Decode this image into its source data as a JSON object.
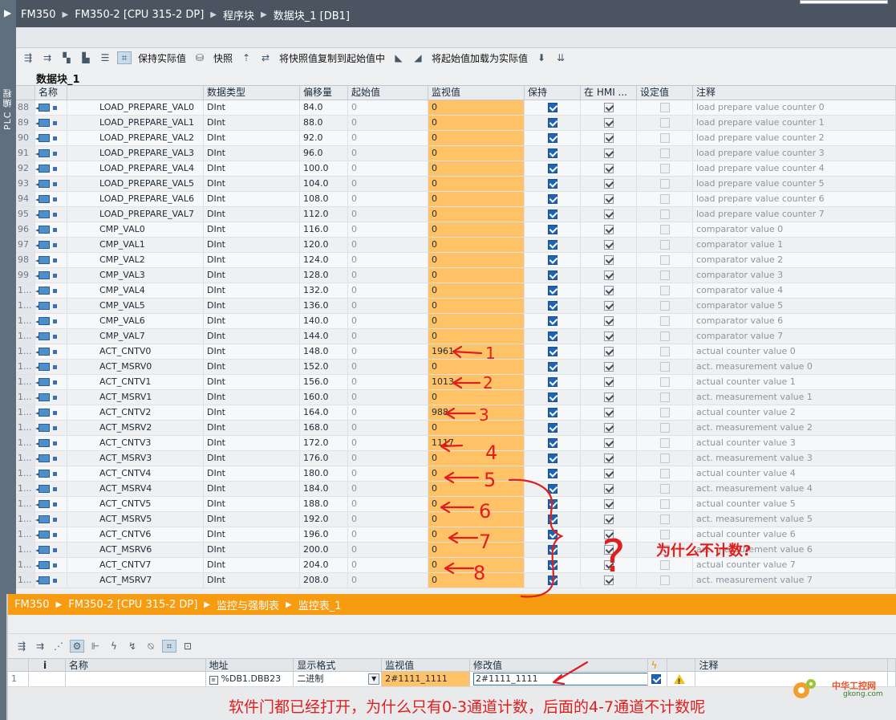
{
  "side": {
    "label": "PLC 编程"
  },
  "breadcrumb": {
    "items": [
      "FM350",
      "FM350-2 [CPU 315-2 DP]",
      "程序块",
      "数据块_1 [DB1]"
    ]
  },
  "toolbar": {
    "keep_actual": "保持实际值",
    "snapshot": "快照",
    "copy_snapshot": "将快照值复制到起始值中",
    "load_start": "将起始值加载为实际值"
  },
  "db_title": "数据块_1",
  "table": {
    "headers": [
      "名称",
      "数据类型",
      "偏移量",
      "起始值",
      "监视值",
      "保持",
      "在 HMI ...",
      "设定值",
      "注释"
    ],
    "rows": [
      {
        "no": "88",
        "name": "LOAD_PREPARE_VAL0",
        "type": "DInt",
        "offset": "84.0",
        "start": "0",
        "mon": "0",
        "comment": "load prepare value counter 0"
      },
      {
        "no": "89",
        "name": "LOAD_PREPARE_VAL1",
        "type": "DInt",
        "offset": "88.0",
        "start": "0",
        "mon": "0",
        "comment": "load prepare value counter 1"
      },
      {
        "no": "90",
        "name": "LOAD_PREPARE_VAL2",
        "type": "DInt",
        "offset": "92.0",
        "start": "0",
        "mon": "0",
        "comment": "load prepare value counter 2"
      },
      {
        "no": "91",
        "name": "LOAD_PREPARE_VAL3",
        "type": "DInt",
        "offset": "96.0",
        "start": "0",
        "mon": "0",
        "comment": "load prepare value counter 3"
      },
      {
        "no": "92",
        "name": "LOAD_PREPARE_VAL4",
        "type": "DInt",
        "offset": "100.0",
        "start": "0",
        "mon": "0",
        "comment": "load prepare value counter 4"
      },
      {
        "no": "93",
        "name": "LOAD_PREPARE_VAL5",
        "type": "DInt",
        "offset": "104.0",
        "start": "0",
        "mon": "0",
        "comment": "load prepare value counter 5"
      },
      {
        "no": "94",
        "name": "LOAD_PREPARE_VAL6",
        "type": "DInt",
        "offset": "108.0",
        "start": "0",
        "mon": "0",
        "comment": "load prepare value counter 6"
      },
      {
        "no": "95",
        "name": "LOAD_PREPARE_VAL7",
        "type": "DInt",
        "offset": "112.0",
        "start": "0",
        "mon": "0",
        "comment": "load prepare value counter 7"
      },
      {
        "no": "96",
        "name": "CMP_VAL0",
        "type": "DInt",
        "offset": "116.0",
        "start": "0",
        "mon": "0",
        "comment": "comparator value 0"
      },
      {
        "no": "97",
        "name": "CMP_VAL1",
        "type": "DInt",
        "offset": "120.0",
        "start": "0",
        "mon": "0",
        "comment": "comparator value 1"
      },
      {
        "no": "98",
        "name": "CMP_VAL2",
        "type": "DInt",
        "offset": "124.0",
        "start": "0",
        "mon": "0",
        "comment": "comparator value 2"
      },
      {
        "no": "99",
        "name": "CMP_VAL3",
        "type": "DInt",
        "offset": "128.0",
        "start": "0",
        "mon": "0",
        "comment": "comparator value 3"
      },
      {
        "no": "1...",
        "name": "CMP_VAL4",
        "type": "DInt",
        "offset": "132.0",
        "start": "0",
        "mon": "0",
        "comment": "comparator value 4"
      },
      {
        "no": "1...",
        "name": "CMP_VAL5",
        "type": "DInt",
        "offset": "136.0",
        "start": "0",
        "mon": "0",
        "comment": "comparator value 5"
      },
      {
        "no": "1...",
        "name": "CMP_VAL6",
        "type": "DInt",
        "offset": "140.0",
        "start": "0",
        "mon": "0",
        "comment": "comparator value 6"
      },
      {
        "no": "1...",
        "name": "CMP_VAL7",
        "type": "DInt",
        "offset": "144.0",
        "start": "0",
        "mon": "0",
        "comment": "comparator value 7"
      },
      {
        "no": "1...",
        "name": "ACT_CNTV0",
        "type": "DInt",
        "offset": "148.0",
        "start": "0",
        "mon": "1961",
        "comment": "actual counter value 0"
      },
      {
        "no": "1...",
        "name": "ACT_MSRV0",
        "type": "DInt",
        "offset": "152.0",
        "start": "0",
        "mon": "0",
        "comment": "act. measurement value 0"
      },
      {
        "no": "1...",
        "name": "ACT_CNTV1",
        "type": "DInt",
        "offset": "156.0",
        "start": "0",
        "mon": "1013",
        "comment": "actual counter value 1"
      },
      {
        "no": "1...",
        "name": "ACT_MSRV1",
        "type": "DInt",
        "offset": "160.0",
        "start": "0",
        "mon": "0",
        "comment": "act. measurement value 1"
      },
      {
        "no": "1...",
        "name": "ACT_CNTV2",
        "type": "DInt",
        "offset": "164.0",
        "start": "0",
        "mon": "988",
        "comment": "actual counter value 2"
      },
      {
        "no": "1...",
        "name": "ACT_MSRV2",
        "type": "DInt",
        "offset": "168.0",
        "start": "0",
        "mon": "0",
        "comment": "act. measurement value 2"
      },
      {
        "no": "1...",
        "name": "ACT_CNTV3",
        "type": "DInt",
        "offset": "172.0",
        "start": "0",
        "mon": "1117",
        "comment": "actual counter value 3"
      },
      {
        "no": "1...",
        "name": "ACT_MSRV3",
        "type": "DInt",
        "offset": "176.0",
        "start": "0",
        "mon": "0",
        "comment": "act. measurement value 3"
      },
      {
        "no": "1...",
        "name": "ACT_CNTV4",
        "type": "DInt",
        "offset": "180.0",
        "start": "0",
        "mon": "0",
        "comment": "actual counter value 4"
      },
      {
        "no": "1...",
        "name": "ACT_MSRV4",
        "type": "DInt",
        "offset": "184.0",
        "start": "0",
        "mon": "0",
        "comment": "act. measurement value 4"
      },
      {
        "no": "1...",
        "name": "ACT_CNTV5",
        "type": "DInt",
        "offset": "188.0",
        "start": "0",
        "mon": "0",
        "comment": "actual counter value 5"
      },
      {
        "no": "1...",
        "name": "ACT_MSRV5",
        "type": "DInt",
        "offset": "192.0",
        "start": "0",
        "mon": "0",
        "comment": "act. measurement value 5"
      },
      {
        "no": "1...",
        "name": "ACT_CNTV6",
        "type": "DInt",
        "offset": "196.0",
        "start": "0",
        "mon": "0",
        "comment": "actual counter value 6"
      },
      {
        "no": "1...",
        "name": "ACT_MSRV6",
        "type": "DInt",
        "offset": "200.0",
        "start": "0",
        "mon": "0",
        "comment": "act. measurement value 6"
      },
      {
        "no": "1...",
        "name": "ACT_CNTV7",
        "type": "DInt",
        "offset": "204.0",
        "start": "0",
        "mon": "0",
        "comment": "actual counter value 7"
      },
      {
        "no": "1...",
        "name": "ACT_MSRV7",
        "type": "DInt",
        "offset": "208.0",
        "start": "0",
        "mon": "0",
        "comment": "act. measurement value 7"
      }
    ]
  },
  "watch": {
    "breadcrumb": [
      "FM350",
      "FM350-2 [CPU 315-2 DP]",
      "监控与强制表",
      "监控表_1"
    ],
    "headers": [
      "i",
      "名称",
      "地址",
      "显示格式",
      "监视值",
      "修改值",
      "注释"
    ],
    "row": {
      "no": "1",
      "name": "",
      "address": "%DB1.DBB23",
      "format": "二进制",
      "monitor": "2#1111_1111",
      "modify": "2#1111_1111"
    }
  },
  "annotations": {
    "numbers": [
      "1",
      "2",
      "3",
      "4",
      "5",
      "6",
      "7",
      "8"
    ],
    "question_mark": "?",
    "question": "为什么不计数?",
    "bottom_note": "软件门都已经打开，为什么只有0-3通道计数，后面的4-7通道不计数呢"
  },
  "watermark": {
    "site": "中华工控网",
    "url": "gkong.com"
  },
  "colors": {
    "monitor_bg": "#ffc266",
    "watch_bar": "#f79b11",
    "annotation": "#e01e1e",
    "checkbox_blue": "#1e64b4"
  }
}
